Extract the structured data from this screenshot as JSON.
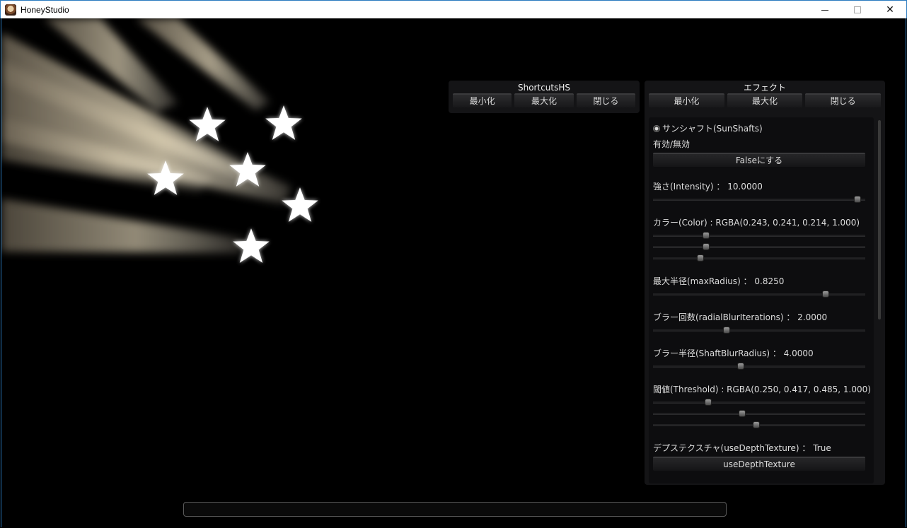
{
  "window": {
    "title": "HoneyStudio",
    "controls": {
      "minimize": "",
      "maximize": "",
      "close": "✕"
    }
  },
  "shortcuts_panel": {
    "title": "ShortcutsHS",
    "buttons": {
      "minimize": "最小化",
      "maximize": "最大化",
      "close": "閉じる"
    }
  },
  "effect_panel": {
    "title": "エフェクト",
    "buttons": {
      "minimize": "最小化",
      "maximize": "最大化",
      "close": "閉じる"
    },
    "section_title": "サンシャフト(SunShafts)",
    "enable_label": "有効/無効",
    "toggle_button": "Falseにする",
    "intensity": {
      "label": "強さ(Intensity) ： 10.0000",
      "value": 10.0,
      "fraction": 0.98
    },
    "color": {
      "label": "カラー(Color) : RGBA(0.243, 0.241, 0.214, 1.000)",
      "r": 0.243,
      "g": 0.241,
      "b": 0.214,
      "a": 1.0
    },
    "max_radius": {
      "label": "最大半径(maxRadius) ： 0.8250",
      "value": 0.825
    },
    "blur_iterations": {
      "label": "ブラー回数(radialBlurIterations) ： 2.0000",
      "value": 2.0,
      "fraction": 0.34
    },
    "blur_radius": {
      "label": "ブラー半径(ShaftBlurRadius) ： 4.0000",
      "value": 4.0,
      "fraction": 0.41
    },
    "threshold": {
      "label": "閾値(Threshold) : RGBA(0.250, 0.417, 0.485, 1.000)",
      "r": 0.25,
      "g": 0.417,
      "b": 0.485,
      "a": 1.0
    },
    "depth_texture": {
      "label": "デプステクスチャ(useDepthTexture) ： True",
      "button": "useDepthTexture"
    }
  },
  "command_input": {
    "value": ""
  },
  "colors": {
    "background": "#000000",
    "panel": "#161618",
    "accent": "#2b7bbf",
    "shaft": "#e8dcc0"
  }
}
